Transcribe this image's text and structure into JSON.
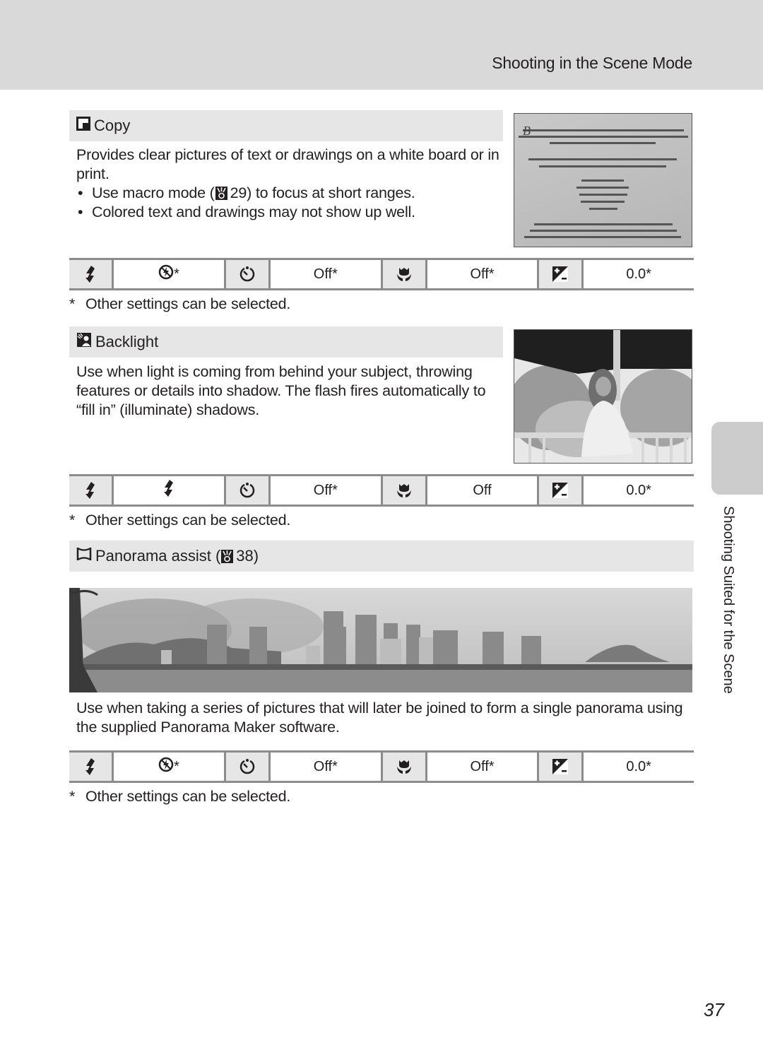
{
  "header": {
    "title": "Shooting in the Scene Mode"
  },
  "side_tab": {
    "label": "Shooting Suited for the Scene"
  },
  "page_number": "37",
  "sections": [
    {
      "id": "copy",
      "icon": "copy-mode-icon",
      "title": "Copy",
      "description": "Provides clear pictures of text or drawings on a white board or in print.",
      "bullets": [
        {
          "before": "Use macro mode (",
          "ref_icon": "reference-icon",
          "ref_page": "29",
          "after": ") to focus at short ranges."
        },
        {
          "text": "Colored text and drawings may not show up well."
        }
      ],
      "image_alt": "Photo of a printed museum plaque with text",
      "settings": {
        "flash": {
          "icon": "flash-mode-icon",
          "value_icon": "flash-off-icon",
          "value": "*"
        },
        "self_timer": {
          "icon": "self-timer-icon",
          "value": "Off*"
        },
        "macro": {
          "icon": "macro-icon",
          "value": "Off*"
        },
        "exposure": {
          "icon": "exposure-compensation-icon",
          "value": "0.0*"
        }
      },
      "footnote": {
        "mark": "*",
        "text": "Other settings can be selected."
      }
    },
    {
      "id": "backlight",
      "icon": "backlight-mode-icon",
      "title": "Backlight",
      "description": "Use when light is coming from behind your subject, throwing features or details into shadow. The flash fires automatically to “fill in” (illuminate) shadows.",
      "image_alt": "Photo of a woman standing under a gazebo roof with bright trees behind",
      "settings": {
        "flash": {
          "icon": "flash-mode-icon",
          "value_icon": "flash-fill-icon",
          "value": ""
        },
        "self_timer": {
          "icon": "self-timer-icon",
          "value": "Off*"
        },
        "macro": {
          "icon": "macro-icon",
          "value": "Off"
        },
        "exposure": {
          "icon": "exposure-compensation-icon",
          "value": "0.0*"
        }
      },
      "footnote": {
        "mark": "*",
        "text": "Other settings can be selected."
      }
    },
    {
      "id": "panorama",
      "icon": "panorama-assist-icon",
      "title": "Panorama assist (",
      "title_ref_icon": "reference-icon",
      "title_ref_page": "38)",
      "image_alt": "Panoramic photo of a city skyline across a bay",
      "description": "Use when taking a series of pictures that will later be joined to form a single panorama using the supplied Panorama Maker software.",
      "settings": {
        "flash": {
          "icon": "flash-mode-icon",
          "value_icon": "flash-off-icon",
          "value": "*"
        },
        "self_timer": {
          "icon": "self-timer-icon",
          "value": "Off*"
        },
        "macro": {
          "icon": "macro-icon",
          "value": "Off*"
        },
        "exposure": {
          "icon": "exposure-compensation-icon",
          "value": "0.0*"
        }
      },
      "footnote": {
        "mark": "*",
        "text": "Other settings can be selected."
      }
    }
  ]
}
